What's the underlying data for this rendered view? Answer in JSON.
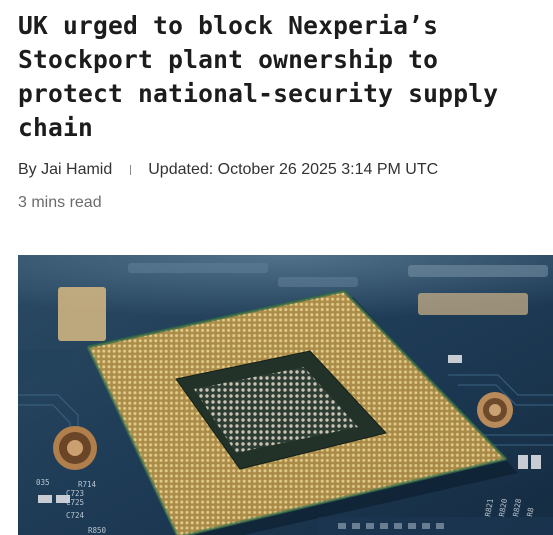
{
  "article": {
    "headline": "UK urged to block Nexperia’s Stockport plant ownership to protect national-security supply chain",
    "author": "By Jai Hamid",
    "updated": "Updated: October 26 2025 3:14 PM UTC",
    "read_time": "3 mins read"
  },
  "hero_image": {
    "board_labels": [
      "035",
      "R714",
      "C723",
      "C725",
      "C724",
      "R821",
      "R820",
      "R828",
      "R8",
      "R850"
    ]
  }
}
